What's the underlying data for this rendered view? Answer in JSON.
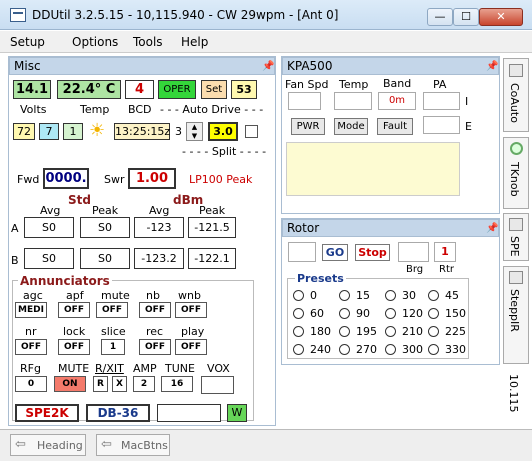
{
  "window": {
    "title": "DDUtil 3.2.5.15 - 10,115.940 - CW 29wpm - [Ant 0]",
    "min": "—",
    "max": "☐",
    "close": "✕"
  },
  "menu": [
    "Setup",
    "Options",
    "Tools",
    "Help"
  ],
  "misc": {
    "title": "Misc",
    "row1": {
      "volts": "14.1",
      "temp": "22.4° C",
      "bcd": "4",
      "oper": "OPER",
      "set": "Set",
      "num": "53"
    },
    "labels1": {
      "volts": "Volts",
      "temp": "Temp",
      "bcd": "BCD",
      "auto": "- - - Auto Drive - - -"
    },
    "row2": {
      "a": "72",
      "b": "7",
      "c": "1",
      "time": "13:25:15z",
      "spin": "3",
      "val": "3.0"
    },
    "split": "- - - - Split - - - -",
    "fwd": {
      "label": "Fwd",
      "value": "0000."
    },
    "swr": {
      "label": "Swr",
      "value": "1.00"
    },
    "lp": "LP100 Peak",
    "std": "Std",
    "dbm": "dBm",
    "cols": [
      "Avg",
      "Peak",
      "Avg",
      "Peak"
    ],
    "rowA": {
      "label": "A",
      "v": [
        "S0",
        "S0",
        "-123",
        "-121.5"
      ]
    },
    "rowB": {
      "label": "B",
      "v": [
        "S0",
        "S0",
        "-123.2",
        "-122.1"
      ]
    },
    "annunciators": "Annunciators",
    "ann1": {
      "labels": [
        "agc",
        "apf",
        "mute",
        "nb",
        "wnb"
      ],
      "values": [
        "MEDI",
        "OFF",
        "OFF",
        "OFF",
        "OFF"
      ]
    },
    "ann2": {
      "labels": [
        "nr",
        "lock",
        "slice",
        "rec",
        "play"
      ],
      "values": [
        "OFF",
        "OFF",
        "1",
        "OFF",
        "OFF"
      ]
    },
    "ann3": {
      "labels": [
        "RFg",
        "MUTE",
        "R/XIT",
        "AMP",
        "TUNE",
        "VOX"
      ],
      "values": [
        "0",
        "ON",
        "R",
        "X",
        "2",
        "16"
      ]
    },
    "bottom": {
      "spe": "SPE2K",
      "db": "DB-36",
      "w": "W"
    }
  },
  "kpa": {
    "title": "KPA500",
    "headers": [
      "Fan Spd",
      "Temp",
      "Band",
      "PA"
    ],
    "band": "0m",
    "i": "I",
    "e": "E",
    "buttons": [
      "PWR",
      "Mode",
      "Fault"
    ]
  },
  "rotor": {
    "title": "Rotor",
    "go": "GO",
    "stop": "Stop",
    "rtr": "1",
    "brg": "Brg",
    "rtrl": "Rtr",
    "presets": "Presets",
    "values": [
      "0",
      "15",
      "30",
      "45",
      "60",
      "90",
      "120",
      "150",
      "180",
      "195",
      "210",
      "225",
      "240",
      "270",
      "300",
      "330"
    ]
  },
  "side": [
    "CoAuto",
    "TKnob",
    "SPE",
    "SteppIR",
    "10.115"
  ],
  "tabs": [
    "Heading",
    "MacBtns"
  ]
}
